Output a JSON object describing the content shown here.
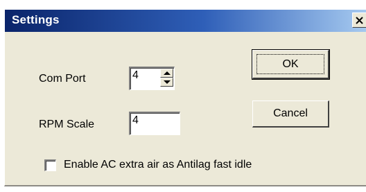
{
  "window": {
    "title": "Settings",
    "close_glyph": "✕"
  },
  "form": {
    "com_port": {
      "label": "Com Port",
      "value": "4"
    },
    "rpm_scale": {
      "label": "RPM Scale",
      "value": "4"
    },
    "antilag_checkbox": {
      "label": "Enable AC extra air as Antilag fast idle",
      "checked": false
    }
  },
  "buttons": {
    "ok_label": "OK",
    "cancel_label": "Cancel"
  },
  "colors": {
    "titlebar_start": "#0a246a",
    "titlebar_end": "#a6caf0",
    "dialog_bg": "#ece9d8"
  }
}
